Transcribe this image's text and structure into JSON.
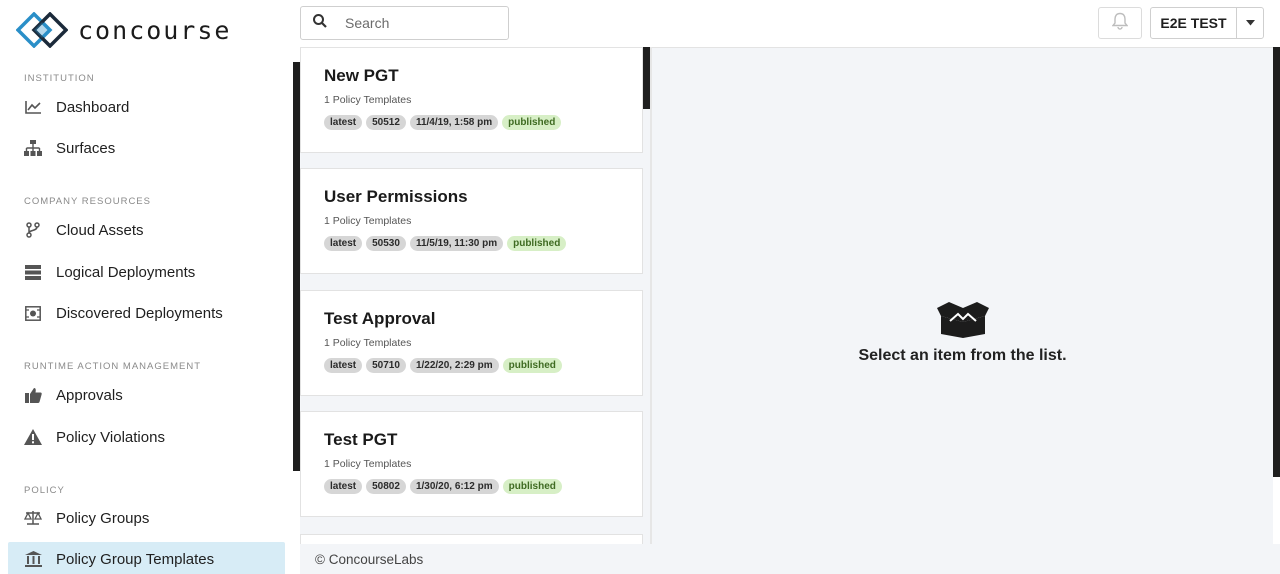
{
  "app": {
    "name": "concourse"
  },
  "sidebar": {
    "sections": [
      {
        "label": "INSTITUTION",
        "items": [
          {
            "label": "Dashboard",
            "icon": "chart-line-icon"
          },
          {
            "label": "Surfaces",
            "icon": "sitemap-icon"
          }
        ]
      },
      {
        "label": "COMPANY RESOURCES",
        "items": [
          {
            "label": "Cloud Assets",
            "icon": "code-branch-icon"
          },
          {
            "label": "Logical Deployments",
            "icon": "server-icon"
          },
          {
            "label": "Discovered Deployments",
            "icon": "discover-icon"
          }
        ]
      },
      {
        "label": "RUNTIME ACTION MANAGEMENT",
        "items": [
          {
            "label": "Approvals",
            "icon": "thumbs-up-icon"
          },
          {
            "label": "Policy Violations",
            "icon": "warning-icon"
          }
        ]
      },
      {
        "label": "POLICY",
        "items": [
          {
            "label": "Policy Groups",
            "icon": "balance-scale-icon"
          },
          {
            "label": "Policy Group Templates",
            "icon": "institution-icon",
            "active": true
          }
        ]
      }
    ]
  },
  "topbar": {
    "search_placeholder": "Search",
    "user_label": "E2E TEST"
  },
  "list": {
    "items": [
      {
        "title": "New PGT",
        "subtitle": "1 Policy Templates",
        "tags": [
          "latest",
          "50512",
          "11/4/19, 1:58 pm",
          "published"
        ]
      },
      {
        "title": "User Permissions",
        "subtitle": "1 Policy Templates",
        "tags": [
          "latest",
          "50530",
          "11/5/19, 11:30 pm",
          "published"
        ]
      },
      {
        "title": "Test Approval",
        "subtitle": "1 Policy Templates",
        "tags": [
          "latest",
          "50710",
          "1/22/20, 2:29 pm",
          "published"
        ]
      },
      {
        "title": "Test PGT",
        "subtitle": "1 Policy Templates",
        "tags": [
          "latest",
          "50802",
          "1/30/20, 6:12 pm",
          "published"
        ]
      }
    ]
  },
  "detail": {
    "empty_message": "Select an item from the list."
  },
  "footer": {
    "text": "© ConcourseLabs"
  },
  "colors": {
    "accent": "#2a8fc8",
    "active_bg": "#d7ecf6",
    "published_bg": "#d7efc6",
    "pane_bg": "#f3f5f8"
  }
}
